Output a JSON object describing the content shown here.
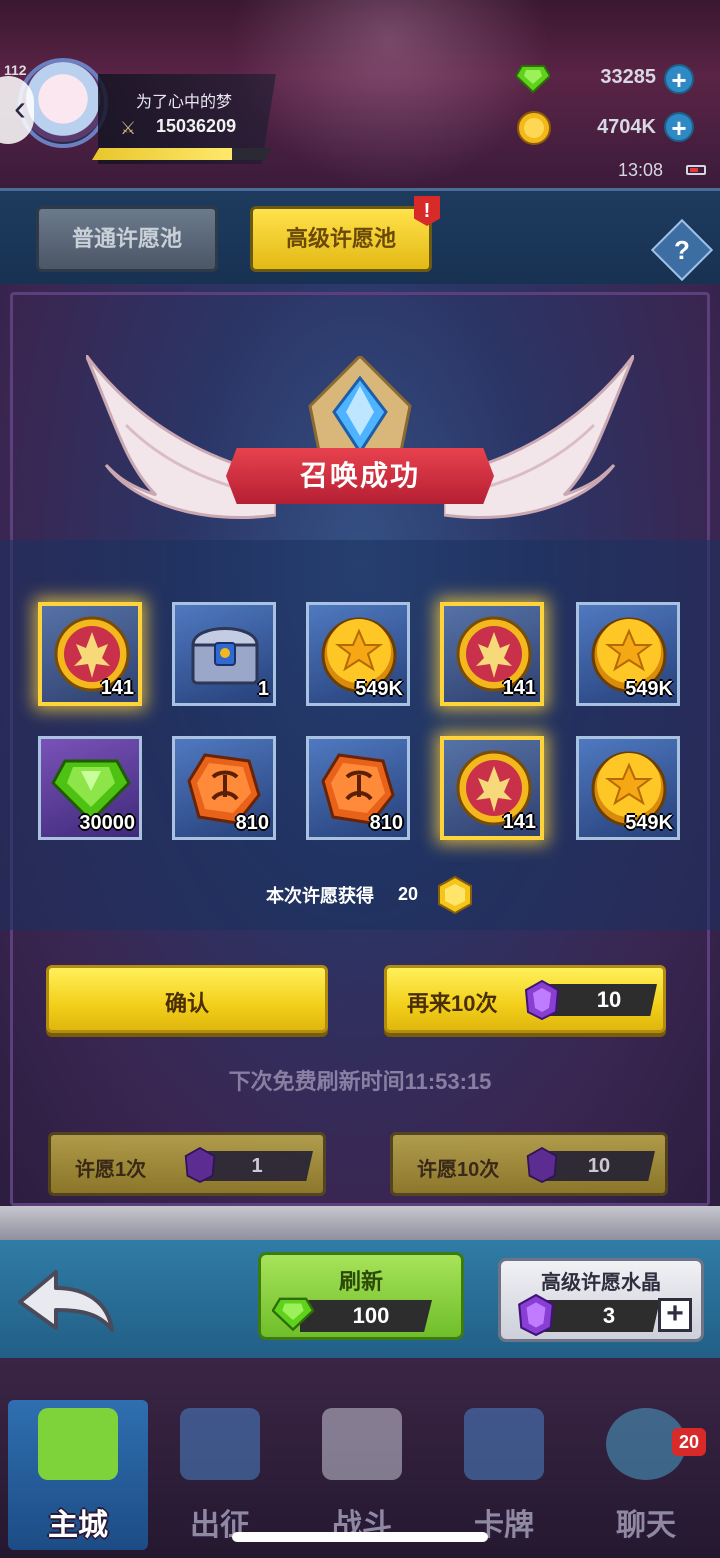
{
  "header": {
    "level": "112",
    "player_name": "为了心中的梦",
    "power": "15036209",
    "exp_fraction": 0.78,
    "gems": "33285",
    "gold": "4704K",
    "time": "13:08",
    "icons": {
      "back": "chevron-left-icon",
      "power": "crossed-swords-icon",
      "gem": "green-gem-icon",
      "coin": "gold-coin-icon",
      "plus": "plus-icon"
    }
  },
  "tabs": {
    "normal": "普通许愿池",
    "premium": "高级许愿池",
    "alert": "!",
    "help": "?"
  },
  "result": {
    "title": "召唤成功",
    "items": [
      {
        "icon": "emblem-coin-icon",
        "count": "141",
        "frame": "gold"
      },
      {
        "icon": "treasure-chest-icon",
        "count": "1",
        "frame": "blue"
      },
      {
        "icon": "gold-coin-icon",
        "count": "549K",
        "frame": "blue"
      },
      {
        "icon": "emblem-coin-icon",
        "count": "141",
        "frame": "gold"
      },
      {
        "icon": "gold-coin-icon",
        "count": "549K",
        "frame": "blue"
      },
      {
        "icon": "green-gem-icon",
        "count": "30000",
        "frame": "purple"
      },
      {
        "icon": "rune-stone-icon",
        "count": "810",
        "frame": "blue"
      },
      {
        "icon": "rune-stone-icon",
        "count": "810",
        "frame": "blue"
      },
      {
        "icon": "emblem-coin-icon",
        "count": "141",
        "frame": "gold"
      },
      {
        "icon": "gold-coin-icon",
        "count": "549K",
        "frame": "blue"
      }
    ],
    "gain_label": "本次许愿获得",
    "gain_value": "20"
  },
  "buttons": {
    "confirm": "确认",
    "again": "再来10次",
    "again_cost": "10",
    "refresh_timer": "下次免费刷新时间11:53:15",
    "wish1": "许愿1次",
    "wish1_cost": "1",
    "wish10": "许愿10次",
    "wish10_cost": "10"
  },
  "lower": {
    "refresh": "刷新",
    "refresh_cost": "100",
    "crystal_label": "高级许愿水晶",
    "crystal_count": "3"
  },
  "nav": {
    "items": [
      "主城",
      "出征",
      "战斗",
      "卡牌",
      "聊天"
    ],
    "chat_badge": "20"
  },
  "colors": {
    "accent_yellow": "#f2cf1a",
    "banner_red": "#d4303f",
    "gold_frame": "#ffd43a"
  }
}
